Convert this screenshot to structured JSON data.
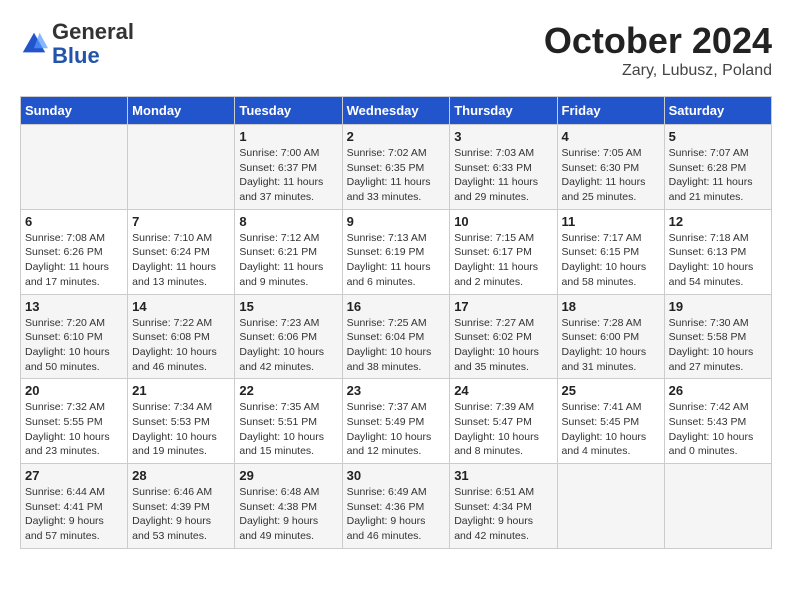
{
  "header": {
    "logo_general": "General",
    "logo_blue": "Blue",
    "month": "October 2024",
    "location": "Zary, Lubusz, Poland"
  },
  "calendar": {
    "days_of_week": [
      "Sunday",
      "Monday",
      "Tuesday",
      "Wednesday",
      "Thursday",
      "Friday",
      "Saturday"
    ],
    "weeks": [
      [
        {
          "day": "",
          "sunrise": "",
          "sunset": "",
          "daylight": ""
        },
        {
          "day": "",
          "sunrise": "",
          "sunset": "",
          "daylight": ""
        },
        {
          "day": "1",
          "sunrise": "Sunrise: 7:00 AM",
          "sunset": "Sunset: 6:37 PM",
          "daylight": "Daylight: 11 hours and 37 minutes."
        },
        {
          "day": "2",
          "sunrise": "Sunrise: 7:02 AM",
          "sunset": "Sunset: 6:35 PM",
          "daylight": "Daylight: 11 hours and 33 minutes."
        },
        {
          "day": "3",
          "sunrise": "Sunrise: 7:03 AM",
          "sunset": "Sunset: 6:33 PM",
          "daylight": "Daylight: 11 hours and 29 minutes."
        },
        {
          "day": "4",
          "sunrise": "Sunrise: 7:05 AM",
          "sunset": "Sunset: 6:30 PM",
          "daylight": "Daylight: 11 hours and 25 minutes."
        },
        {
          "day": "5",
          "sunrise": "Sunrise: 7:07 AM",
          "sunset": "Sunset: 6:28 PM",
          "daylight": "Daylight: 11 hours and 21 minutes."
        }
      ],
      [
        {
          "day": "6",
          "sunrise": "Sunrise: 7:08 AM",
          "sunset": "Sunset: 6:26 PM",
          "daylight": "Daylight: 11 hours and 17 minutes."
        },
        {
          "day": "7",
          "sunrise": "Sunrise: 7:10 AM",
          "sunset": "Sunset: 6:24 PM",
          "daylight": "Daylight: 11 hours and 13 minutes."
        },
        {
          "day": "8",
          "sunrise": "Sunrise: 7:12 AM",
          "sunset": "Sunset: 6:21 PM",
          "daylight": "Daylight: 11 hours and 9 minutes."
        },
        {
          "day": "9",
          "sunrise": "Sunrise: 7:13 AM",
          "sunset": "Sunset: 6:19 PM",
          "daylight": "Daylight: 11 hours and 6 minutes."
        },
        {
          "day": "10",
          "sunrise": "Sunrise: 7:15 AM",
          "sunset": "Sunset: 6:17 PM",
          "daylight": "Daylight: 11 hours and 2 minutes."
        },
        {
          "day": "11",
          "sunrise": "Sunrise: 7:17 AM",
          "sunset": "Sunset: 6:15 PM",
          "daylight": "Daylight: 10 hours and 58 minutes."
        },
        {
          "day": "12",
          "sunrise": "Sunrise: 7:18 AM",
          "sunset": "Sunset: 6:13 PM",
          "daylight": "Daylight: 10 hours and 54 minutes."
        }
      ],
      [
        {
          "day": "13",
          "sunrise": "Sunrise: 7:20 AM",
          "sunset": "Sunset: 6:10 PM",
          "daylight": "Daylight: 10 hours and 50 minutes."
        },
        {
          "day": "14",
          "sunrise": "Sunrise: 7:22 AM",
          "sunset": "Sunset: 6:08 PM",
          "daylight": "Daylight: 10 hours and 46 minutes."
        },
        {
          "day": "15",
          "sunrise": "Sunrise: 7:23 AM",
          "sunset": "Sunset: 6:06 PM",
          "daylight": "Daylight: 10 hours and 42 minutes."
        },
        {
          "day": "16",
          "sunrise": "Sunrise: 7:25 AM",
          "sunset": "Sunset: 6:04 PM",
          "daylight": "Daylight: 10 hours and 38 minutes."
        },
        {
          "day": "17",
          "sunrise": "Sunrise: 7:27 AM",
          "sunset": "Sunset: 6:02 PM",
          "daylight": "Daylight: 10 hours and 35 minutes."
        },
        {
          "day": "18",
          "sunrise": "Sunrise: 7:28 AM",
          "sunset": "Sunset: 6:00 PM",
          "daylight": "Daylight: 10 hours and 31 minutes."
        },
        {
          "day": "19",
          "sunrise": "Sunrise: 7:30 AM",
          "sunset": "Sunset: 5:58 PM",
          "daylight": "Daylight: 10 hours and 27 minutes."
        }
      ],
      [
        {
          "day": "20",
          "sunrise": "Sunrise: 7:32 AM",
          "sunset": "Sunset: 5:55 PM",
          "daylight": "Daylight: 10 hours and 23 minutes."
        },
        {
          "day": "21",
          "sunrise": "Sunrise: 7:34 AM",
          "sunset": "Sunset: 5:53 PM",
          "daylight": "Daylight: 10 hours and 19 minutes."
        },
        {
          "day": "22",
          "sunrise": "Sunrise: 7:35 AM",
          "sunset": "Sunset: 5:51 PM",
          "daylight": "Daylight: 10 hours and 15 minutes."
        },
        {
          "day": "23",
          "sunrise": "Sunrise: 7:37 AM",
          "sunset": "Sunset: 5:49 PM",
          "daylight": "Daylight: 10 hours and 12 minutes."
        },
        {
          "day": "24",
          "sunrise": "Sunrise: 7:39 AM",
          "sunset": "Sunset: 5:47 PM",
          "daylight": "Daylight: 10 hours and 8 minutes."
        },
        {
          "day": "25",
          "sunrise": "Sunrise: 7:41 AM",
          "sunset": "Sunset: 5:45 PM",
          "daylight": "Daylight: 10 hours and 4 minutes."
        },
        {
          "day": "26",
          "sunrise": "Sunrise: 7:42 AM",
          "sunset": "Sunset: 5:43 PM",
          "daylight": "Daylight: 10 hours and 0 minutes."
        }
      ],
      [
        {
          "day": "27",
          "sunrise": "Sunrise: 6:44 AM",
          "sunset": "Sunset: 4:41 PM",
          "daylight": "Daylight: 9 hours and 57 minutes."
        },
        {
          "day": "28",
          "sunrise": "Sunrise: 6:46 AM",
          "sunset": "Sunset: 4:39 PM",
          "daylight": "Daylight: 9 hours and 53 minutes."
        },
        {
          "day": "29",
          "sunrise": "Sunrise: 6:48 AM",
          "sunset": "Sunset: 4:38 PM",
          "daylight": "Daylight: 9 hours and 49 minutes."
        },
        {
          "day": "30",
          "sunrise": "Sunrise: 6:49 AM",
          "sunset": "Sunset: 4:36 PM",
          "daylight": "Daylight: 9 hours and 46 minutes."
        },
        {
          "day": "31",
          "sunrise": "Sunrise: 6:51 AM",
          "sunset": "Sunset: 4:34 PM",
          "daylight": "Daylight: 9 hours and 42 minutes."
        },
        {
          "day": "",
          "sunrise": "",
          "sunset": "",
          "daylight": ""
        },
        {
          "day": "",
          "sunrise": "",
          "sunset": "",
          "daylight": ""
        }
      ]
    ]
  }
}
